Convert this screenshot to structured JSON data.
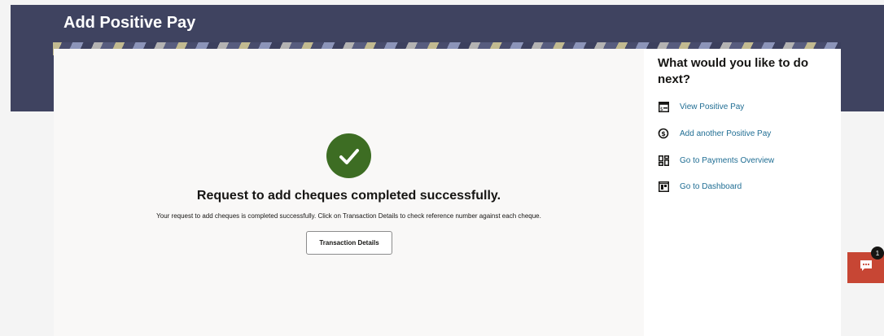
{
  "page": {
    "title": "Add Positive Pay"
  },
  "main": {
    "success_title": "Request to add cheques completed successfully.",
    "success_message": "Your request to add cheques is completed successfully. Click on Transaction Details to check reference number against each cheque.",
    "transaction_details_label": "Transaction Details",
    "success_icon": "check-circle-icon",
    "success_color": "#3d6d23"
  },
  "next_steps": {
    "heading": "What would you like to do next?",
    "links": [
      {
        "label": "View Positive Pay",
        "icon": "cheque-icon"
      },
      {
        "label": "Add another Positive Pay",
        "icon": "dollar-circle-icon"
      },
      {
        "label": "Go to Payments Overview",
        "icon": "overview-grid-icon"
      },
      {
        "label": "Go to Dashboard",
        "icon": "dashboard-icon"
      }
    ],
    "link_color": "#1f6d93"
  },
  "chat": {
    "badge_count": "1",
    "icon": "chat-icon",
    "color": "#c74634"
  },
  "theme": {
    "banner_color": "#3f4360"
  }
}
